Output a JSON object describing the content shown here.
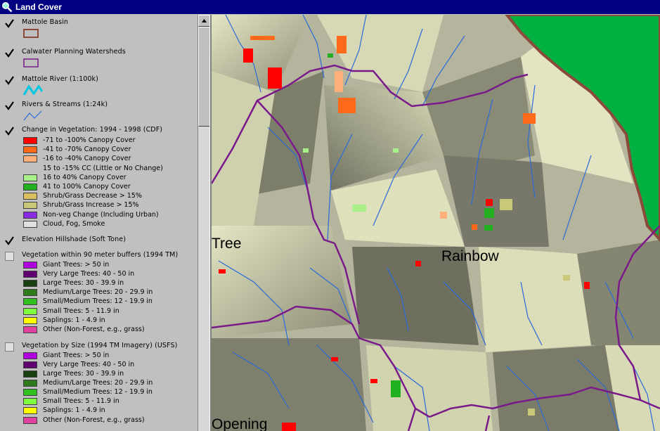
{
  "window": {
    "title": "Land Cover",
    "icon": "magnifier-icon"
  },
  "legend": {
    "layers": [
      {
        "id": "basin",
        "name": "Mattole Basin",
        "checked": true,
        "symbol": "basin-outline"
      },
      {
        "id": "calwater",
        "name": "Calwater Planning Watersheds",
        "checked": true,
        "symbol": "watershed-outline"
      },
      {
        "id": "river",
        "name": "Mattole River (1:100k)",
        "checked": true,
        "symbol": "river-line"
      },
      {
        "id": "streams",
        "name": "Rivers & Streams (1:24k)",
        "checked": true,
        "symbol": "stream-line"
      },
      {
        "id": "change",
        "name": "Change in Vegetation: 1994 - 1998 (CDF)",
        "checked": true,
        "classes": [
          {
            "label": "-71 to -100% Canopy Cover",
            "color": "#ff0000"
          },
          {
            "label": "-41 to -70% Canopy Cover",
            "color": "#ff6a1a"
          },
          {
            "label": "-16 to -40% Canopy Cover",
            "color": "#ffb07a"
          },
          {
            "label": "15 to -15% CC (Little or No Change)",
            "color": ""
          },
          {
            "label": "16 to 40% Canopy Cover",
            "color": "#a8f08a"
          },
          {
            "label": "41 to 100% Canopy Cover",
            "color": "#20b020"
          },
          {
            "label": "Shrub/Grass Decrease > 15%",
            "color": "#d8c060"
          },
          {
            "label": "Shrub/Grass Increase > 15%",
            "color": "#c8c878"
          },
          {
            "label": "Non-veg Change (Including Urban)",
            "color": "#8a2be2"
          },
          {
            "label": "Cloud, Fog, Smoke",
            "color": "#e0e0e0"
          }
        ]
      },
      {
        "id": "hillshade",
        "name": "Elevation Hillshade (Soft Tone)",
        "checked": true
      },
      {
        "id": "veg90",
        "name": "Vegetation within 90 meter buffers (1994 TM)",
        "checked": false,
        "classes": [
          {
            "label": "Giant Trees: > 50 in",
            "color": "#b000e0"
          },
          {
            "label": "Very Large Trees: 40 - 50 in",
            "color": "#600070"
          },
          {
            "label": "Large Trees: 30 - 39.9 in",
            "color": "#184010"
          },
          {
            "label": "Medium/Large Trees: 20 - 29.9 in",
            "color": "#2e7a1c"
          },
          {
            "label": "Small/Medium Trees: 12 - 19.9 in",
            "color": "#30c020"
          },
          {
            "label": "Small Trees: 5 - 11.9 in",
            "color": "#80ff40"
          },
          {
            "label": "Saplings: 1 - 4.9 in",
            "color": "#ffff00"
          },
          {
            "label": "Other (Non-Forest, e.g., grass)",
            "color": "#e040a0"
          }
        ]
      },
      {
        "id": "vegsize",
        "name": "Vegetation by Size (1994 TM Imagery) (USFS)",
        "checked": false,
        "classes": [
          {
            "label": "Giant Trees: > 50 in",
            "color": "#b000e0"
          },
          {
            "label": "Very Large Trees: 40 - 50 in",
            "color": "#600070"
          },
          {
            "label": "Large Trees: 30 - 39.9 in",
            "color": "#184010"
          },
          {
            "label": "Medium/Large Trees: 20 - 29.9 in",
            "color": "#2e7a1c"
          },
          {
            "label": "Small/Medium Trees: 12 - 19.9 in",
            "color": "#30c020"
          },
          {
            "label": "Small Trees: 5 - 11.9 in",
            "color": "#80ff40"
          },
          {
            "label": "Saplings: 1 - 4.9 in",
            "color": "#ffff00"
          },
          {
            "label": "Other (Non-Forest, e.g., grass)",
            "color": "#e040a0"
          }
        ]
      }
    ]
  },
  "map": {
    "labels": {
      "tree": "Tree",
      "rainbow": "Rainbow",
      "opening": "Opening"
    },
    "colors": {
      "basin": "#8b4a3a",
      "watershed": "#7a1a8a",
      "river": "#00c8e0",
      "stream": "#2a6ad8",
      "ocean": "#00b040",
      "terrain": "#b4b59c"
    }
  }
}
